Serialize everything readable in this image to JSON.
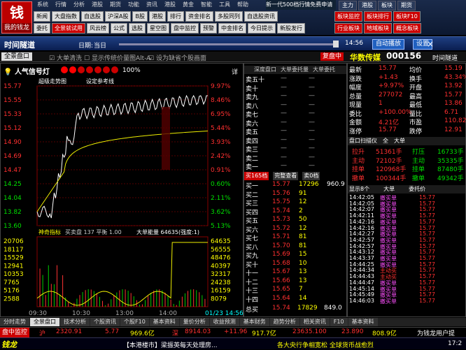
{
  "app": {
    "logo": "我的钱龙",
    "logo_char": "钱"
  },
  "menu": [
    "系统",
    "行情",
    "分析",
    "港股",
    "期货",
    "功能",
    "资讯",
    "港股",
    "黄金",
    "智能",
    "工具",
    "帮助"
  ],
  "news": "新一代500档行情免费申请",
  "rtabs": [
    "主力",
    "港股",
    "板块",
    "期货"
  ],
  "toolbar1": [
    "新闻",
    "大盘指数",
    "自选股",
    "沪深A股",
    "B股",
    "港股",
    "排行",
    "资金排名",
    "多股同列",
    "自选股资讯"
  ],
  "toolbar2": [
    "委托",
    "全景就试用",
    "风云榜",
    "公式",
    "选股",
    "星空图",
    "盘中监控",
    "预警",
    "中金排名",
    "今日提示",
    "新股发行"
  ],
  "rtool1": [
    "板块监控",
    "板块排行",
    "板块F10"
  ],
  "rtool2": [
    "行业板块",
    "地域板块",
    "概念板块"
  ],
  "tunnel": {
    "title": "时间隧道",
    "date_label": "日期:",
    "date_value": "当日",
    "time": "14:56",
    "auto_play": "自动播放",
    "settings": "设置"
  },
  "viewbar": {
    "tab": "全景盘口",
    "opt1": "大单清洗",
    "opt2": "显示传统价量图Alt-A",
    "opt3": "设为缺省个股画面",
    "recover": "复盘中"
  },
  "stock": {
    "name": "华数传媒",
    "code": "000156"
  },
  "timeline": "时间隧道",
  "signal": {
    "title": "人气信号灯",
    "pct": "100%",
    "btn": "详"
  },
  "chart": {
    "label1": "超级走势图",
    "label2": "设定参考线",
    "price_levels": [
      "15.77",
      "15.55",
      "15.33",
      "15.12",
      "14.90",
      "14.69",
      "14.47",
      "14.25",
      "14.04",
      "13.82",
      "13.60"
    ],
    "pct_levels": [
      "9.97%",
      "8.46%",
      "6.95%",
      "5.44%",
      "3.93%",
      "2.42%",
      "0.91%",
      "0.60%",
      "2.11%",
      "3.62%",
      "5.13%"
    ],
    "vol_levels": [
      "20706",
      "18117",
      "15529",
      "12941",
      "10353",
      "7765",
      "5176",
      "2588"
    ],
    "vol_right": [
      "64635",
      "56555",
      "48476",
      "40397",
      "32317",
      "24238",
      "16159",
      "8079"
    ],
    "ind_label": "神奇指标",
    "ind_vals": "买卖盘 137  平衡 1.00",
    "ind_right": "大单能量 64635(强度:1)",
    "times": [
      "09:30",
      "10:30",
      "13:00",
      "14:00"
    ],
    "cur_time": "01/23 14:56"
  },
  "depth": {
    "tabs": [
      "深度盘口",
      "大单委托量",
      "大单委托"
    ],
    "sell": [
      "卖五十",
      "卖十",
      "卖九",
      "卖八",
      "卖七",
      "卖六",
      "卖五",
      "卖四",
      "卖三",
      "卖二",
      "卖一"
    ],
    "buy_hdr": [
      "买165档",
      "完整查看",
      "卖0档"
    ],
    "buys": [
      [
        "买一",
        "15.77",
        "17296"
      ],
      [
        "买二",
        "15.76",
        "91"
      ],
      [
        "买三",
        "15.75",
        "12"
      ],
      [
        "买四",
        "15.74",
        "2"
      ],
      [
        "买五",
        "15.73",
        "50"
      ],
      [
        "买六",
        "15.72",
        "12"
      ],
      [
        "买七",
        "15.71",
        "81"
      ],
      [
        "买八",
        "15.70",
        "81"
      ],
      [
        "买九",
        "15.69",
        "15"
      ],
      [
        "买十",
        "15.68",
        "10"
      ],
      [
        "十一",
        "15.67",
        "13"
      ],
      [
        "十二",
        "15.66",
        "13"
      ],
      [
        "十三",
        "15.65",
        "7"
      ],
      [
        "十四",
        "15.64",
        "14"
      ]
    ],
    "buy1_side": "960.9",
    "total": [
      "总买",
      "15.74",
      "17829",
      "849.0"
    ]
  },
  "quote": [
    [
      "最新",
      "15.77",
      "均价",
      "15.19"
    ],
    [
      "涨跌",
      "+1.43",
      "换手",
      "43.34%"
    ],
    [
      "幅度",
      "+9.97%",
      "开盘",
      "13.92"
    ],
    [
      "总量",
      "277072",
      "最高",
      "15.77"
    ],
    [
      "现量",
      "1",
      "最低",
      "13.86"
    ],
    [
      "委比",
      "+100.00%",
      "量比",
      "6.71"
    ],
    [
      "金额",
      "4.21亿",
      "市盈",
      "110.82"
    ],
    [
      "涨停",
      "15.77",
      "跌停",
      "12.91"
    ]
  ],
  "flow": {
    "tabs": [
      "盘口扫描仪",
      "全",
      "大单"
    ],
    "rows": [
      [
        "拉升",
        "51361手",
        "打压",
        "16733手"
      ],
      [
        "主动",
        "72102手",
        "主动",
        "35335手"
      ],
      [
        "挂单",
        "120968手",
        "挂单",
        "87480手"
      ],
      [
        "撤单",
        "100344手",
        "撤单",
        "49342手"
      ]
    ]
  },
  "ticks": {
    "hdr": [
      "显示8个",
      "大单",
      "委托价"
    ],
    "rows": [
      [
        "14:42:05",
        "撤买单",
        "15.77"
      ],
      [
        "14:42:05",
        "撤买单",
        "15.77"
      ],
      [
        "14:42:07",
        "撤买单",
        "15.77"
      ],
      [
        "14:42:11",
        "撤买单",
        "15.77"
      ],
      [
        "14:42:16",
        "撤买单",
        "15.77"
      ],
      [
        "14:42:16",
        "撤买单",
        "15.77"
      ],
      [
        "14:42:27",
        "撤买单",
        "15.77"
      ],
      [
        "14:42:57",
        "撤买单",
        "15.77"
      ],
      [
        "14:42:57",
        "撤买单",
        "15.77"
      ],
      [
        "14:43:12",
        "撤买单",
        "15.77"
      ],
      [
        "14:43:37",
        "撤买单",
        "15.77"
      ],
      [
        "14:44:25",
        "撤买单",
        "15.77"
      ],
      [
        "14:44:34",
        "主动买",
        "15.77"
      ],
      [
        "14:44:43",
        "主动买",
        "15.77"
      ],
      [
        "14:44:47",
        "撤买单",
        "15.77"
      ],
      [
        "14:45:14",
        "撤买单",
        "15.77"
      ],
      [
        "14:45:49",
        "撤买单",
        "15.77"
      ],
      [
        "14:46:03",
        "撤买单",
        "15.77"
      ]
    ]
  },
  "bottomtabs": [
    "分时走势",
    "全景盘口",
    "技术分析",
    "个股资讯",
    "个股F10",
    "基本资料",
    "量价分析",
    "收益预测",
    "基本财务",
    "趋势分析",
    "相关资讯",
    "F10",
    "基本资料"
  ],
  "status": {
    "monitor": "盘中监控",
    "sh": "沪",
    "sh_v": "2320.91",
    "sh_c": "5.77",
    "sh_a": "969.6亿",
    "sz": "深",
    "sz_v": "8914.03",
    "sz_c": "+11.96",
    "sz_a": "917.7亿",
    "c3": "23635.100",
    "c4": "23.890",
    "c5": "808.9亿",
    "right": "为钱龙用户提"
  },
  "ticker": {
    "brand": "钱龙",
    "t1": "【本港楼市】梁振英每天处理房...",
    "t2": "各大央行争相宽松 全球货币战愈烈",
    "time": "17:2"
  }
}
